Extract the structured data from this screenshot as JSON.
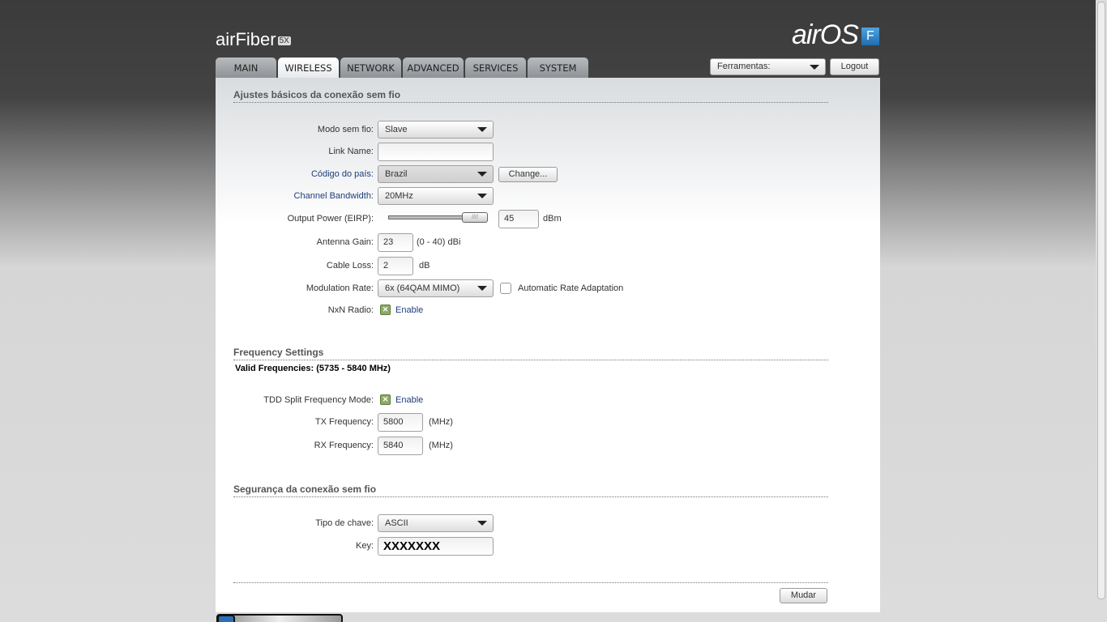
{
  "brand": {
    "left_logo": "airFiber",
    "left_badge": "5X",
    "right_logo": "airOS",
    "right_badge": "F"
  },
  "tabs": [
    {
      "label": "MAIN"
    },
    {
      "label": "WIRELESS"
    },
    {
      "label": "NETWORK"
    },
    {
      "label": "ADVANCED"
    },
    {
      "label": "SERVICES"
    },
    {
      "label": "SYSTEM"
    }
  ],
  "header": {
    "tools": "Ferramentas:",
    "logout": "Logout"
  },
  "basic": {
    "title": "Ajustes básicos da conexão sem fio",
    "mode_label": "Modo sem fio:",
    "mode_value": "Slave",
    "link_label": "Link Name:",
    "link_value": "",
    "country_label": "Código do país:",
    "country_value": "Brazil",
    "change": "Change...",
    "bw_label": "Channel Bandwidth:",
    "bw_value": "20MHz",
    "power_label": "Output Power (EIRP):",
    "power_value": "45",
    "power_unit": "dBm",
    "power_fraction": 1.0,
    "gain_label": "Antenna Gain:",
    "gain_value": "23",
    "gain_unit": "(0 - 40) dBi",
    "loss_label": "Cable Loss:",
    "loss_value": "2",
    "loss_unit": "dB",
    "mod_label": "Modulation Rate:",
    "mod_value": "6x (64QAM MIMO)",
    "auto_rate": "Automatic Rate Adaptation",
    "nxn_label": "NxN Radio:",
    "nxn_enable": "Enable"
  },
  "freq": {
    "title": "Frequency Settings",
    "valid": "Valid Frequencies: (5735 - 5840 MHz)",
    "tdd_label": "TDD Split Frequency Mode:",
    "tdd_enable": "Enable",
    "tx_label": "TX Frequency:",
    "tx_value": "5800",
    "rx_label": "RX Frequency:",
    "rx_value": "5840",
    "unit": "(MHz)"
  },
  "security": {
    "title": "Segurança da conexão sem fio",
    "keytype_label": "Tipo de chave:",
    "keytype_value": "ASCII",
    "key_label": "Key:",
    "key_value": "XXXXXXX"
  },
  "apply": "Mudar"
}
